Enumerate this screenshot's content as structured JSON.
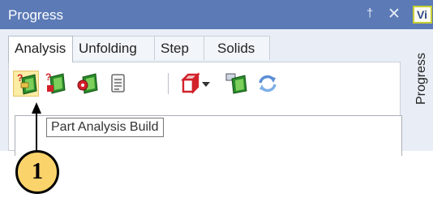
{
  "panel": {
    "title": "Progress",
    "pin_glyph": "†",
    "close_glyph": "✕"
  },
  "vi_tab": {
    "label": "Vi"
  },
  "side_tab": {
    "label": "Progress"
  },
  "tabs": [
    {
      "label": "Analysis",
      "active": true
    },
    {
      "label": "Unfolding",
      "active": false
    },
    {
      "label": "Step",
      "active": false
    },
    {
      "label": "Solids",
      "active": false
    }
  ],
  "toolbar": {
    "buttons": [
      {
        "icon": "part-analysis-build-icon",
        "active": true
      },
      {
        "icon": "part-analysis-red-icon"
      },
      {
        "icon": "analysis-gear-icon"
      },
      {
        "icon": "report-icon"
      },
      {
        "icon": "red-cube-icon"
      },
      {
        "icon": "dropdown-arrow-icon"
      },
      {
        "icon": "analysis-settings-icon"
      },
      {
        "icon": "refresh-icon"
      }
    ]
  },
  "tooltip": {
    "text": "Part Analysis Build"
  },
  "callout": {
    "number": "1"
  },
  "colors": {
    "titlebar": "#5b7ab6",
    "accent_yellow": "#fbd36b",
    "cube_red": "#d2212a",
    "green": "#2b8a2b"
  }
}
